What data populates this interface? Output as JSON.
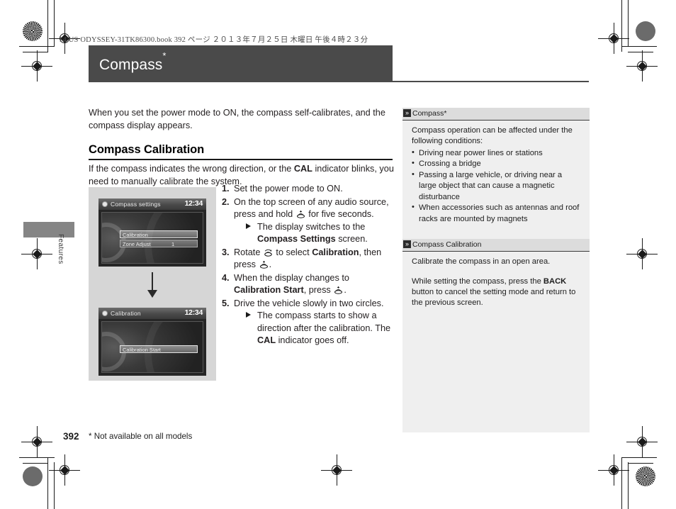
{
  "print": {
    "file_header": "14 US ODYSSEY-31TK86300.book   392 ページ   ２０１３年７月２５日   木曜日   午後４時２３分"
  },
  "header": {
    "title": "Compass",
    "asterisk": "*"
  },
  "margin": {
    "tab_label": "Features"
  },
  "main": {
    "intro": "When you set the power mode to ON, the compass self-calibrates, and the compass display appears.",
    "section_title": "Compass Calibration",
    "lead_part1": "If the compass indicates the wrong direction, or the ",
    "lead_cal": "CAL",
    "lead_part2": " indicator blinks, you need to manually calibrate the system."
  },
  "figure": {
    "screen1": {
      "title": "Compass settings",
      "clock": "12:34",
      "rows": [
        {
          "label": "Calibration",
          "value": "",
          "selected": true
        },
        {
          "label": "Zone Adjust",
          "value": "1",
          "selected": false
        }
      ]
    },
    "arrow": "down-arrow",
    "screen2": {
      "title": "Calibration",
      "clock": "12:34",
      "rows": [
        {
          "label": "Calibration Start",
          "value": "",
          "selected": true
        }
      ]
    }
  },
  "steps": [
    {
      "num": "1.",
      "text": "Set the power mode to ON."
    },
    {
      "num": "2.",
      "text_a": "On the top screen of any audio source, press and hold ",
      "icon": "knob-press-icon",
      "text_b": " for five seconds.",
      "sub_a": "The display switches to the ",
      "sub_bold": "Compass Settings",
      "sub_b": " screen."
    },
    {
      "num": "3.",
      "text_a": "Rotate ",
      "icon": "knob-rotate-icon",
      "text_b": " to select ",
      "bold": "Calibration",
      "text_c": ", then press ",
      "icon2": "knob-press-icon",
      "text_d": "."
    },
    {
      "num": "4.",
      "text_a": "When the display changes to ",
      "bold": "Calibration Start",
      "text_b": ", press ",
      "icon": "knob-press-icon",
      "text_c": "."
    },
    {
      "num": "5.",
      "text": "Drive the vehicle slowly in two circles.",
      "sub_a": "The compass starts to show a direction after the calibration. The ",
      "sub_bold": "CAL",
      "sub_b": " indicator goes off."
    }
  ],
  "aside": {
    "section1": {
      "heading": "Compass",
      "heading_asterisk": "*",
      "intro": "Compass operation can be affected under the following conditions:",
      "bullets": [
        "Driving near power lines or stations",
        "Crossing a bridge",
        "Passing a large vehicle, or driving near a large object that can cause a magnetic disturbance",
        "When accessories such as antennas and roof racks are mounted by magnets"
      ]
    },
    "section2": {
      "heading": "Compass Calibration",
      "para1": "Calibrate the compass in an open area.",
      "para2_a": "While setting the compass, press the ",
      "para2_bold": "BACK",
      "para2_b": " button to cancel the setting mode and return to the previous screen."
    }
  },
  "footer": {
    "page_number": "392",
    "footnote": "* Not available on all models"
  },
  "colors": {
    "title_bar": "#4a4a4a",
    "figure_bg": "#d6d6d6",
    "aside_bg": "#efefef",
    "aside_header_bg": "#dcdcdc",
    "margin_tab": "#858585"
  }
}
